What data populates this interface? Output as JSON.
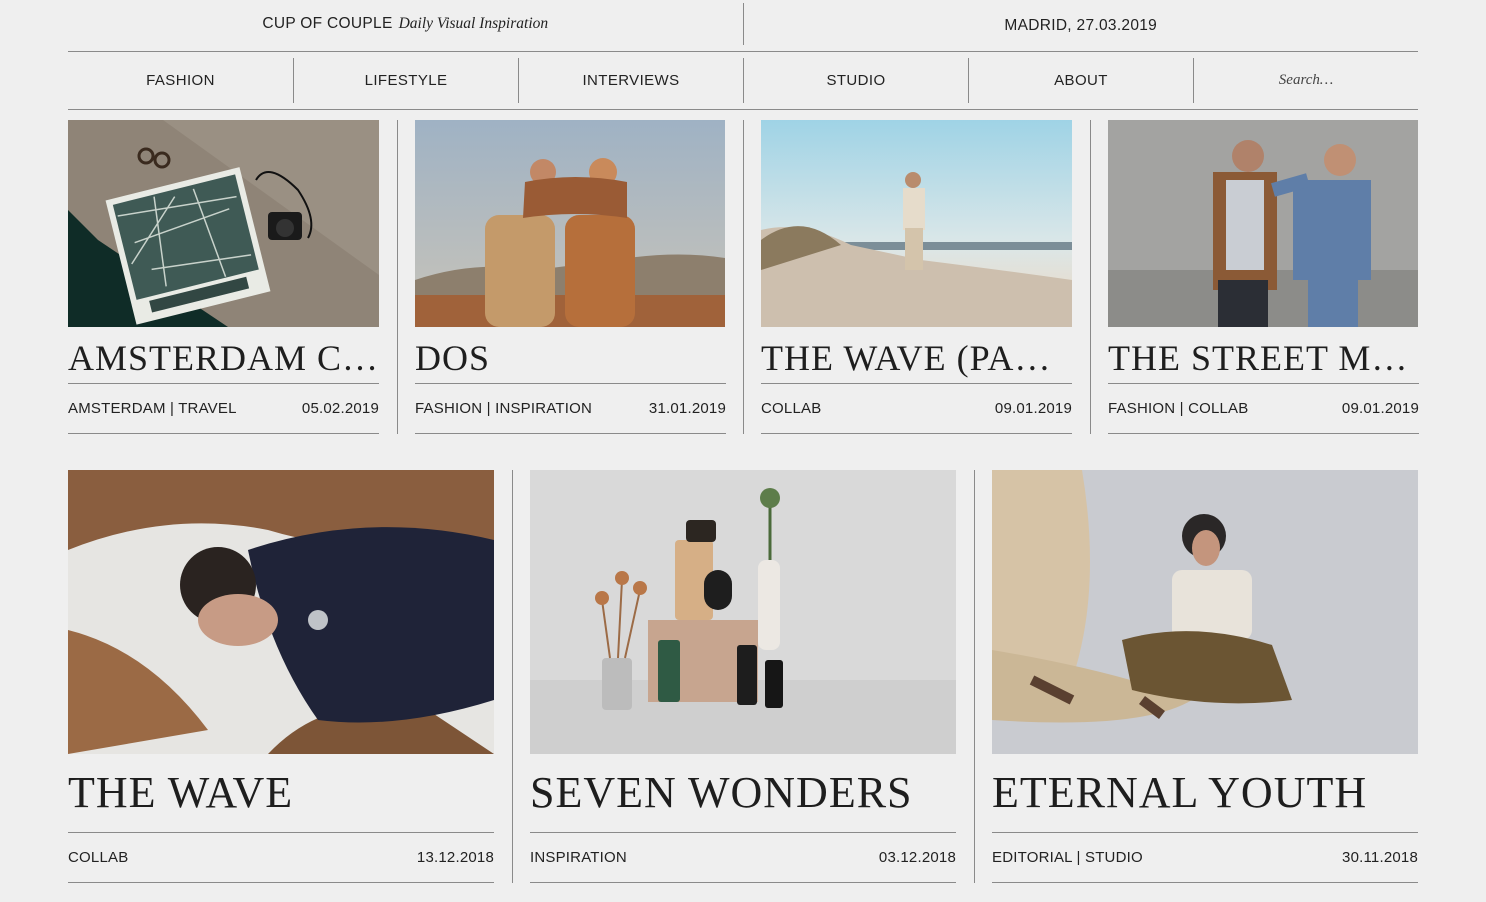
{
  "header": {
    "brand": "CUP OF COUPLE",
    "tagline": "Daily Visual Inspiration",
    "location_date": "MADRID, 27.03.2019"
  },
  "nav": {
    "items": [
      "FASHION",
      "LIFESTYLE",
      "INTERVIEWS",
      "STUDIO",
      "ABOUT"
    ],
    "search_placeholder": "Search…"
  },
  "posts": [
    {
      "title": "AMSTERDAM CITY GUIDE",
      "tags": "AMSTERDAM | TRAVEL",
      "date": "05.02.2019"
    },
    {
      "title": "DOS",
      "tags": "FASHION | INSPIRATION",
      "date": "31.01.2019"
    },
    {
      "title": "THE WAVE (PART II)",
      "tags": "COLLAB",
      "date": "09.01.2019"
    },
    {
      "title": "THE STREET MOVEMENT",
      "tags": "FASHION | COLLAB",
      "date": "09.01.2019"
    },
    {
      "title": "THE WAVE",
      "tags": "COLLAB",
      "date": "13.12.2018"
    },
    {
      "title": "SEVEN WONDERS",
      "tags": "INSPIRATION",
      "date": "03.12.2018"
    },
    {
      "title": "ETERNAL YOUTH",
      "tags": "EDITORIAL | STUDIO",
      "date": "30.11.2018"
    }
  ],
  "colors": {
    "background": "#efefef",
    "rule": "#8a8a8a",
    "text": "#222222"
  }
}
